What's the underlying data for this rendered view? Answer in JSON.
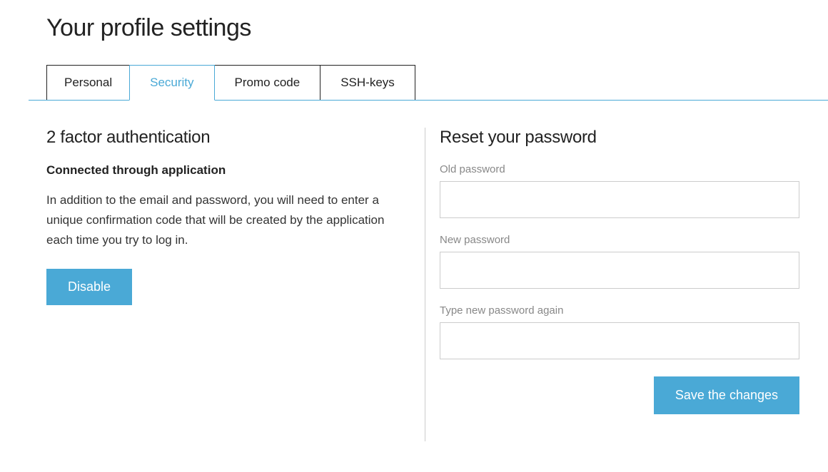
{
  "page": {
    "title": "Your profile settings"
  },
  "tabs": {
    "personal": "Personal",
    "security": "Security",
    "promo": "Promo code",
    "ssh": "SSH-keys"
  },
  "twofa": {
    "title": "2 factor authentication",
    "status": "Connected through application",
    "description": "In addition to the email and password, you will need to enter a unique confirmation code that will be created by the application each time you try to log in.",
    "disable_label": "Disable"
  },
  "password": {
    "title": "Reset your password",
    "old_label": "Old password",
    "new_label": "New password",
    "confirm_label": "Type new password again",
    "save_label": "Save the changes"
  }
}
